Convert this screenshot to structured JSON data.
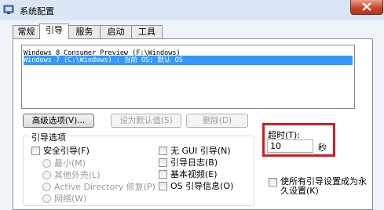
{
  "window": {
    "title": "系统配置"
  },
  "tabs": [
    {
      "label": "常规",
      "active": false
    },
    {
      "label": "引导",
      "active": true
    },
    {
      "label": "服务",
      "active": false
    },
    {
      "label": "启动",
      "active": false
    },
    {
      "label": "工具",
      "active": false
    }
  ],
  "os_list": [
    {
      "text": "Windows 8 Consumer Preview (F:\\Windows)",
      "selected": false
    },
    {
      "text": "Windows 7 (C:\\Windows) : 当前 OS; 默认 OS",
      "selected": true
    }
  ],
  "buttons": {
    "advanced": "高级选项(V)...",
    "set_default": "设为默认值(S)",
    "delete": "删除(D)"
  },
  "boot_options": {
    "title": "引导选项",
    "safe_boot": "安全引导(F)",
    "minimal": "最小(M)",
    "alternate_shell": "其他外壳(L)",
    "ad_repair": "Active Directory 修复(P)",
    "network": "网络(W)",
    "no_gui": "无 GUI 引导(N)",
    "boot_log": "引导日志(B)",
    "base_video": "基本视频(E)",
    "os_boot_info": "OS 引导信息(O)"
  },
  "timeout": {
    "label": "超时(T):",
    "value": "10",
    "unit": "秒"
  },
  "make_permanent": "使所有引导设置成为永久设置(K)",
  "colors": {
    "selection": "#3399ff",
    "highlight_border": "#cc1f1f",
    "close_button": "#c9462c"
  }
}
